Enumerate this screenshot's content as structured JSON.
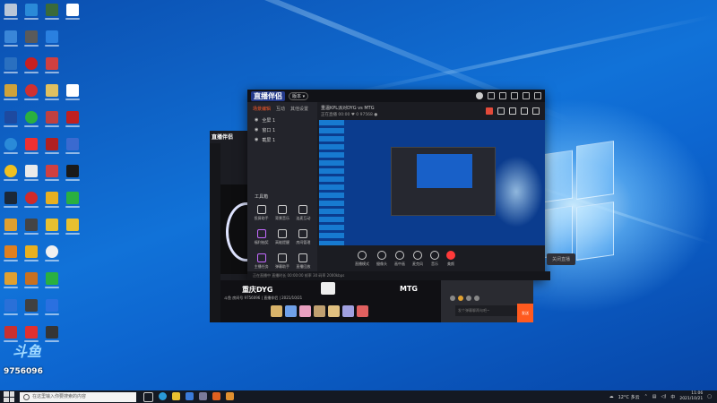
{
  "app": {
    "logo": "直播伴侣",
    "version_pill": "版本 ▾",
    "tabs": [
      "场景编辑",
      "互动",
      "其他设置"
    ],
    "scenes": [
      "全屏 1",
      "窗口 1",
      "截屏 1"
    ],
    "header_title": "重温KPL派对DYG vs MTG",
    "header_sub": "正在直播  00:00  ♥ 0  97568  ●",
    "tools_title": "工具箱",
    "tools": [
      "投屏助手",
      "背景音乐",
      "连麦互动",
      "福利抽奖",
      "高能提醒",
      "房间管理",
      "主播任务",
      "弹幕助手",
      "直播回放"
    ],
    "controls": [
      "直播模式",
      "摄像头",
      "画中画",
      "麦克风",
      "音乐",
      "美颜",
      "声卡"
    ],
    "live_button": "关闭直播",
    "status_text": "正在直播中  直播时长 00:00:00  帧率 30  码率 2000kbps"
  },
  "stream": {
    "team_left": "重庆DYG",
    "team_right": "MTG",
    "ticker": "斗鱼 房间号 9756096 | 直播伴侣 | 2021/10/21",
    "chat_placeholder": "发个弹幕聊两句吧~",
    "send_label": "发送"
  },
  "overlay": {
    "logo": "斗鱼",
    "room_number": "9756096"
  },
  "taskbar": {
    "search_placeholder": "在这里输入你要搜索的内容",
    "weather": "12°C 多云",
    "time": "11:06",
    "date": "2021/10/21"
  },
  "colors": {
    "accent": "#ff5a1f",
    "desktop": "#0a5dc4",
    "taskbar": "#141923"
  }
}
